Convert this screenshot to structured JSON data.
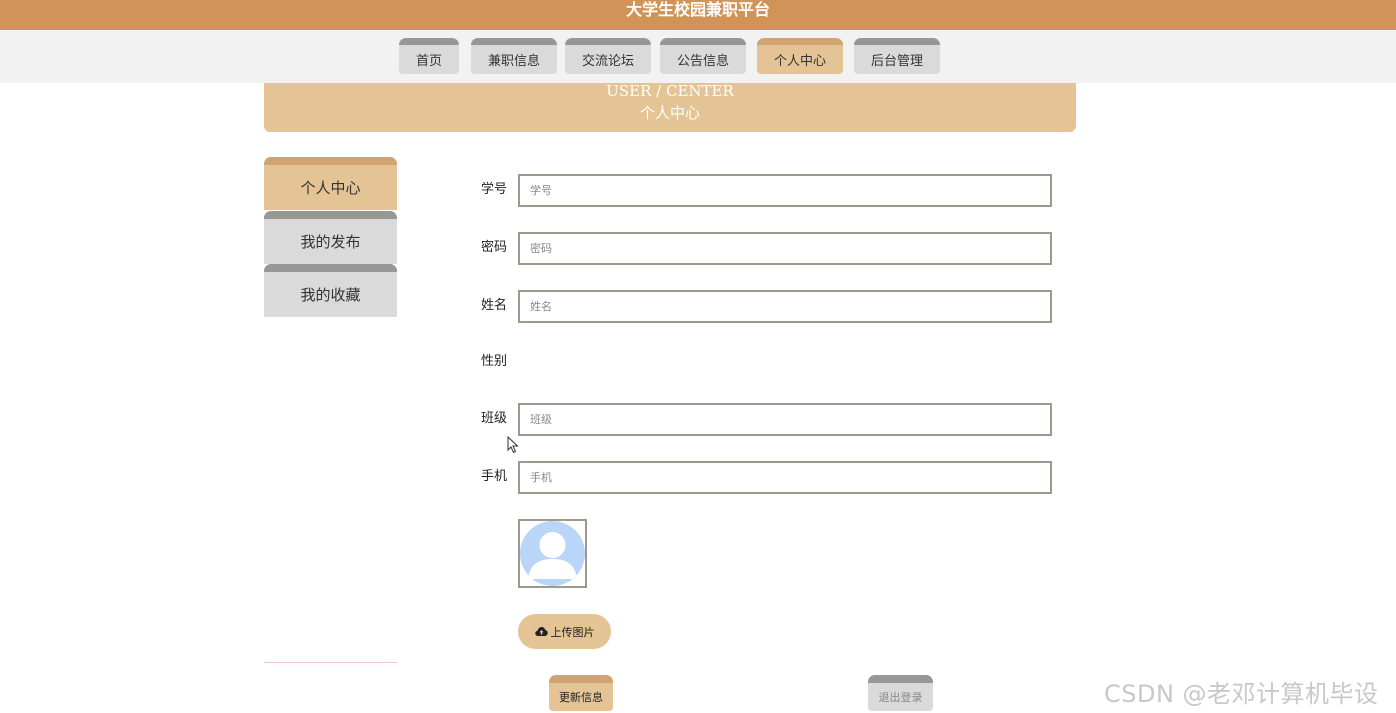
{
  "header": {
    "title": "大学生校园兼职平台"
  },
  "nav": {
    "items": [
      {
        "label": "首页"
      },
      {
        "label": "兼职信息"
      },
      {
        "label": "交流论坛"
      },
      {
        "label": "公告信息"
      },
      {
        "label": "个人中心"
      },
      {
        "label": "后台管理"
      }
    ],
    "active": "个人中心"
  },
  "banner": {
    "en": "USER / CENTER",
    "cn": "个人中心"
  },
  "sidebar": {
    "items": [
      {
        "label": "个人中心"
      },
      {
        "label": "我的发布"
      },
      {
        "label": "我的收藏"
      }
    ],
    "active": "个人中心"
  },
  "form": {
    "student_id": {
      "label": "学号",
      "value": "",
      "placeholder": "学号"
    },
    "password": {
      "label": "密码",
      "value": "",
      "placeholder": "密码"
    },
    "name": {
      "label": "姓名",
      "value": "",
      "placeholder": "姓名"
    },
    "gender": {
      "label": "性别"
    },
    "class": {
      "label": "班级",
      "value": "",
      "placeholder": "班级"
    },
    "phone": {
      "label": "手机",
      "value": "",
      "placeholder": "手机"
    },
    "avatar_icon": "default-user-avatar-icon",
    "upload_label": "上传图片",
    "upload_icon": "cloud-upload-icon"
  },
  "actions": {
    "update_label": "更新信息",
    "logout_label": "退出登录"
  },
  "watermark": "CSDN @老邓计算机毕设",
  "colors": {
    "topbar": "#d09458",
    "accent": "#e4c495",
    "accent_border": "#d1a371",
    "tab_inactive": "#dadada",
    "tab_border": "#979797",
    "avatar": "#b9d6f8"
  }
}
